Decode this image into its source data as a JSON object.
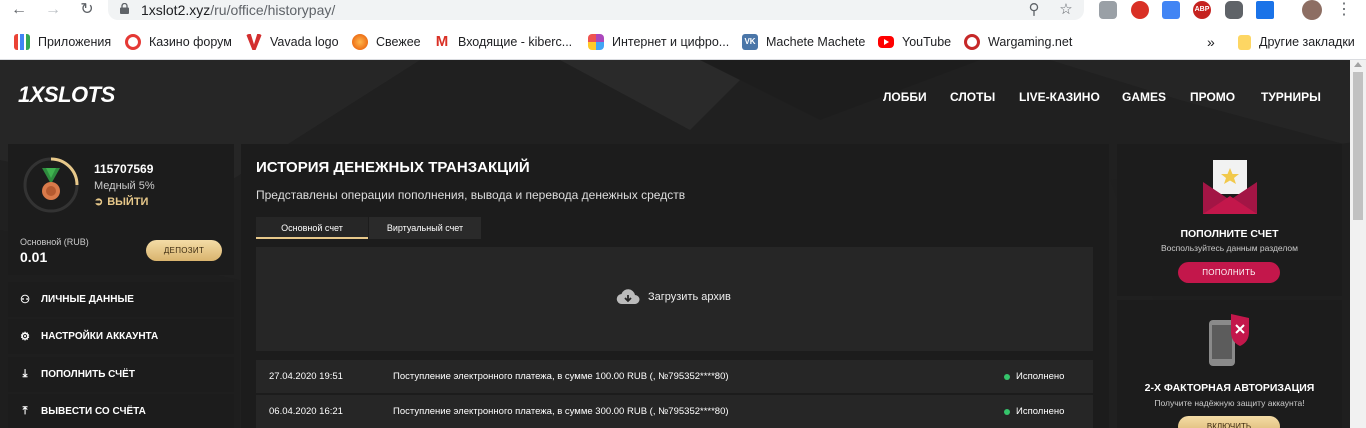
{
  "browser": {
    "url_host": "1xslot2.xyz",
    "url_path": "/ru/office/historypay/",
    "bookmarks": [
      {
        "label": "Приложения",
        "icon": "apps-grid-icon"
      },
      {
        "label": "Казино форум",
        "icon": "casino-forum-icon"
      },
      {
        "label": "Vavada logo",
        "icon": "vavada-icon"
      },
      {
        "label": "Свежее",
        "icon": "svezhee-icon"
      },
      {
        "label": "Входящие - kiberc...",
        "icon": "gmail-icon"
      },
      {
        "label": "Интернет и цифро...",
        "icon": "puzzle-icon"
      },
      {
        "label": "Machete Machete",
        "icon": "vk-icon"
      },
      {
        "label": "YouTube",
        "icon": "youtube-icon"
      },
      {
        "label": "Wargaming.net",
        "icon": "wargaming-icon"
      }
    ],
    "more_bookmarks": "»",
    "other_bookmarks": "Другие закладки",
    "abp_label": "ABP"
  },
  "site": {
    "logo": "1XSLOTS",
    "nav": [
      "ЛОББИ",
      "СЛОТЫ",
      "LIVE-КАЗИНО",
      "GAMES",
      "ПРОМО",
      "ТУРНИРЫ"
    ]
  },
  "user": {
    "id": "115707569",
    "level": "Медный 5%",
    "logout": "ВЫЙТИ",
    "balance_label": "Основной (RUB)",
    "balance_value": "0.01",
    "deposit_label": "ДЕПОЗИТ"
  },
  "menu": [
    {
      "label": "ЛИЧНЫЕ ДАННЫЕ",
      "icon": "user-plus-icon"
    },
    {
      "label": "НАСТРОЙКИ АККАУНТА",
      "icon": "gears-icon"
    },
    {
      "label": "ПОПОЛНИТЬ СЧЁТ",
      "icon": "download-icon"
    },
    {
      "label": "ВЫВЕСТИ СО СЧЁТА",
      "icon": "upload-icon"
    }
  ],
  "main": {
    "title": "ИСТОРИЯ ДЕНЕЖНЫХ ТРАНЗАКЦИЙ",
    "subtitle": "Представлены операции пополнения, вывода и перевода денежных средств",
    "tabs": [
      "Основной счет",
      "Виртуальный счет"
    ],
    "archive_label": "Загрузить архив",
    "transactions": [
      {
        "date": "27.04.2020 19:51",
        "description": "Поступление электронного платежа, в сумме 100.00 RUB (, №795352****80)",
        "status": "Исполнено"
      },
      {
        "date": "06.04.2020 16:21",
        "description": "Поступление электронного платежа, в сумме 300.00 RUB (, №795352****80)",
        "status": "Исполнено"
      }
    ]
  },
  "promo": {
    "topup_title": "ПОПОЛНИТЕ СЧЕТ",
    "topup_sub": "Воспользуйтесь данным разделом",
    "topup_btn": "ПОПОЛНИТЬ",
    "twofa_title": "2-Х ФАКТОРНАЯ АВТОРИЗАЦИЯ",
    "twofa_sub": "Получите надёжную защиту аккаунта!",
    "twofa_btn": "ВКЛЮЧИТЬ"
  },
  "colors": {
    "gold": "#e7c88a",
    "pink": "#c3174b",
    "status_green": "#35c46b"
  }
}
